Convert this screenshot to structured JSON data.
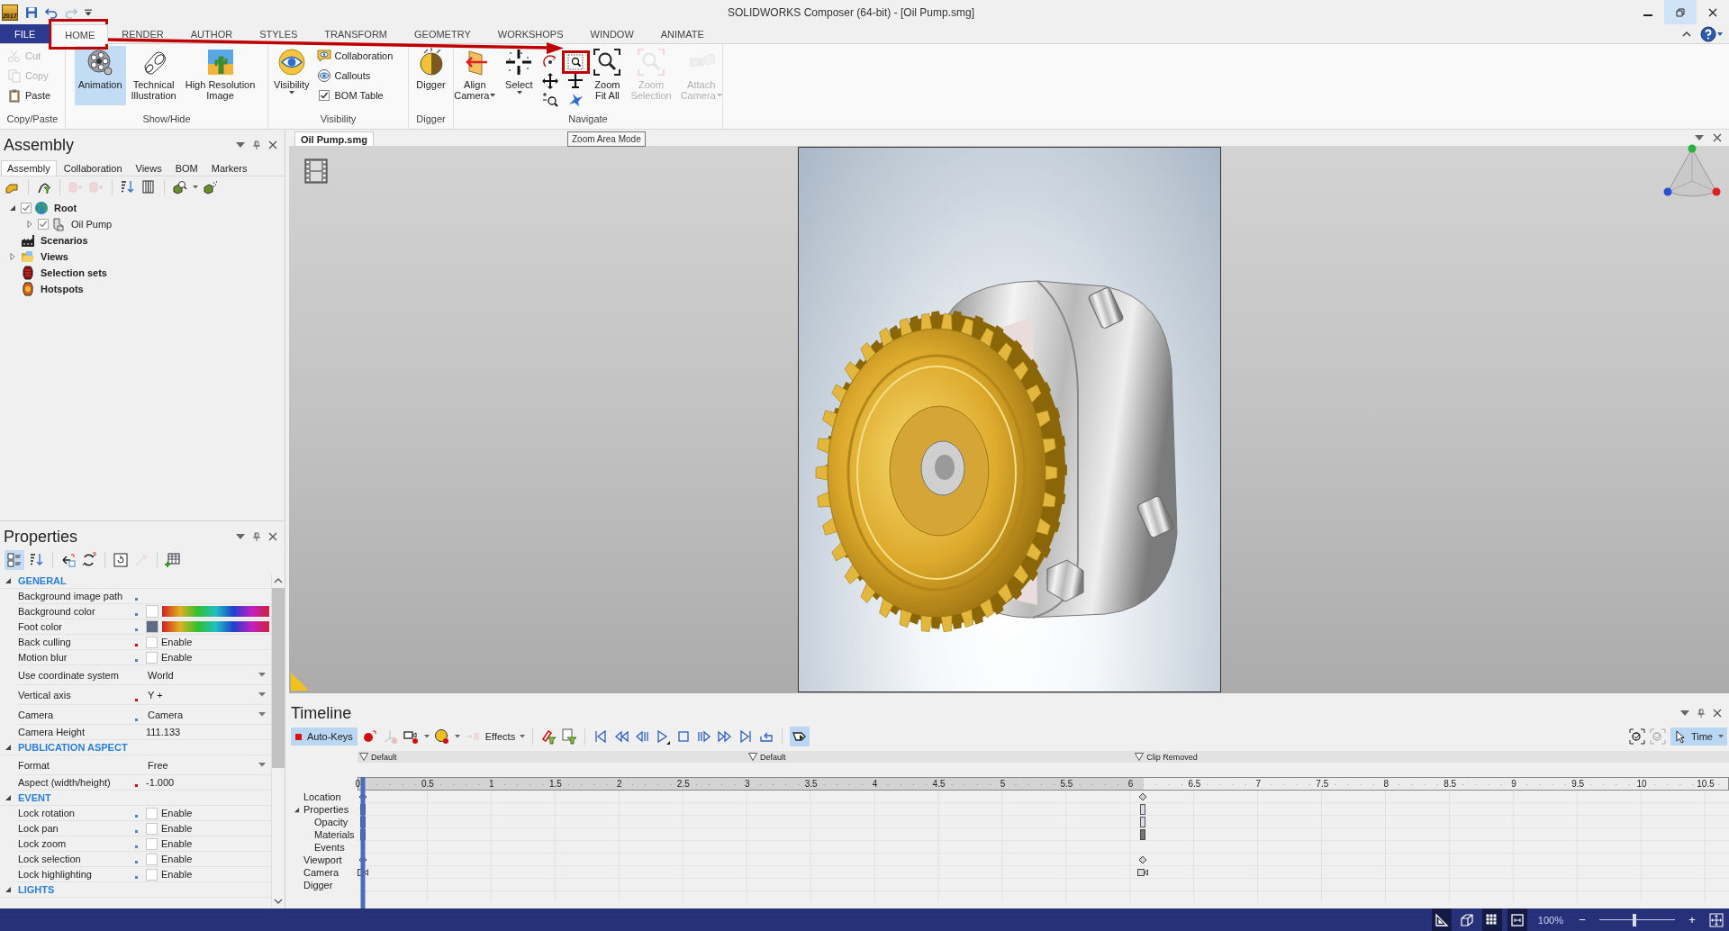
{
  "window": {
    "icon_text": "2017",
    "title": "SOLIDWORKS Composer (64-bit) - [Oil Pump.smg]"
  },
  "quick_access": [
    {
      "disabled": false
    },
    {
      "disabled": false
    },
    {
      "disabled": true
    }
  ],
  "window_controls": [
    {
      "kind": "minimize",
      "hovered": false
    },
    {
      "kind": "restore",
      "hovered": true
    },
    {
      "kind": "close",
      "hovered": false
    }
  ],
  "ribbon_tabs": [
    {
      "label": "FILE",
      "kind": "file",
      "selected": false
    },
    {
      "label": "HOME",
      "kind": "tab",
      "selected": true
    },
    {
      "label": "RENDER",
      "kind": "tab",
      "selected": false
    },
    {
      "label": "AUTHOR",
      "kind": "tab",
      "selected": false
    },
    {
      "label": "STYLES",
      "kind": "tab",
      "selected": false
    },
    {
      "label": "TRANSFORM",
      "kind": "tab",
      "selected": false
    },
    {
      "label": "GEOMETRY",
      "kind": "tab",
      "selected": false
    },
    {
      "label": "WORKSHOPS",
      "kind": "tab",
      "selected": false
    },
    {
      "label": "WINDOW",
      "kind": "tab",
      "selected": false
    },
    {
      "label": "ANIMATE",
      "kind": "tab",
      "selected": false
    }
  ],
  "ribbon_groups": [
    {
      "label": "Copy/Paste",
      "items": [
        {
          "label": "Cut",
          "disabled": true
        },
        {
          "label": "Copy",
          "disabled": true
        },
        {
          "label": "Paste",
          "disabled": false
        }
      ]
    },
    {
      "label": "Show/Hide",
      "items": [
        {
          "lines": [
            "Animation"
          ],
          "selected": true
        },
        {
          "lines": [
            "Technical",
            "Illustration"
          ],
          "selected": false
        },
        {
          "lines": [
            "High Resolution",
            "Image"
          ],
          "selected": false
        }
      ]
    },
    {
      "label": "Visibility",
      "items": [
        {
          "lines": [
            "Visibility"
          ],
          "menu": true
        }
      ],
      "small_items": [
        {
          "label": "Collaboration"
        },
        {
          "label": "Callouts"
        },
        {
          "label": "BOM Table",
          "checked": true
        }
      ]
    },
    {
      "label": "Digger",
      "items": [
        {
          "lines": [
            "Digger"
          ]
        }
      ]
    },
    {
      "label": "Navigate",
      "items": [
        {
          "lines": [
            "Align",
            "Camera"
          ],
          "menu": true,
          "disabled": false
        },
        {
          "lines": [
            "Select"
          ],
          "menu": true,
          "disabled": false
        },
        {
          "lines": [
            "Zoom",
            "Fit All"
          ],
          "menu": false,
          "disabled": false
        },
        {
          "lines": [
            "Zoom",
            "Selection"
          ],
          "menu": false,
          "disabled": true
        },
        {
          "lines": [
            "Attach",
            "Camera"
          ],
          "menu": true,
          "disabled": true
        }
      ]
    }
  ],
  "tooltip": "Zoom Area Mode",
  "assembly_panel": {
    "title": "Assembly",
    "tabs": [
      {
        "label": "Assembly",
        "selected": true
      },
      {
        "label": "Collaboration",
        "selected": false
      },
      {
        "label": "Views",
        "selected": false
      },
      {
        "label": "BOM",
        "selected": false
      },
      {
        "label": "Markers",
        "selected": false
      }
    ],
    "toolbar": [
      {
        "disabled": false
      },
      {
        "disabled": false
      },
      {
        "disabled": true
      },
      {
        "disabled": true
      },
      {
        "disabled": false
      },
      {
        "disabled": false
      },
      {
        "disabled": false
      },
      {
        "disabled": false
      }
    ],
    "tree": [
      {
        "label": "Root",
        "kind": "root",
        "expanded": true,
        "checked": true,
        "children": [
          {
            "label": "Oil Pump",
            "kind": "part",
            "expanded": false,
            "checked": true
          }
        ]
      },
      {
        "label": "Scenarios",
        "kind": "scenarios"
      },
      {
        "label": "Views",
        "kind": "views",
        "expanded": false
      },
      {
        "label": "Selection sets",
        "kind": "selection"
      },
      {
        "label": "Hotspots",
        "kind": "hotspots"
      }
    ]
  },
  "properties_panel": {
    "title": "Properties",
    "toolbar": [
      {
        "selected": true,
        "disabled": false
      },
      {
        "selected": false,
        "disabled": false
      },
      {
        "selected": false,
        "disabled": false
      },
      {
        "selected": false,
        "disabled": false
      },
      {
        "selected": false,
        "disabled": false
      },
      {
        "selected": false,
        "disabled": true
      },
      {
        "selected": false,
        "disabled": false
      }
    ],
    "sections": [
      {
        "label": "GENERAL",
        "expanded": true,
        "rows": [
          {
            "label": "Background image path",
            "color": "#4a86d0",
            "kind": "empty"
          },
          {
            "label": "Background color",
            "color": "#4a86d0",
            "kind": "color",
            "swatch": {
              "color": "#ffffff"
            }
          },
          {
            "label": "Foot color",
            "color": "#4a86d0",
            "kind": "color",
            "swatch": {
              "color": "#5d6b86"
            }
          },
          {
            "label": "Back culling",
            "color": "#e00000",
            "kind": "check",
            "checked": false,
            "value": "Enable"
          },
          {
            "label": "Motion blur",
            "color": "#4a86d0",
            "kind": "check",
            "checked": false,
            "value": "Enable"
          },
          {
            "label": "Use coordinate system",
            "kind": "dropdown",
            "value": "World"
          },
          {
            "label": "Vertical axis",
            "color": "#e00000",
            "kind": "dropdown",
            "value": "Y +"
          },
          {
            "label": "Camera",
            "color": "#4a86d0",
            "kind": "dropdown",
            "value": "Camera"
          },
          {
            "label": "Camera Height",
            "kind": "text",
            "value": "111.133"
          }
        ]
      },
      {
        "label": "PUBLICATION ASPECT",
        "expanded": true,
        "rows": [
          {
            "label": "Format",
            "kind": "dropdown",
            "value": "Free"
          },
          {
            "label": "Aspect (width/height)",
            "color": "#e00000",
            "kind": "text",
            "value": "-1.000"
          }
        ]
      },
      {
        "label": "EVENT",
        "expanded": true,
        "rows": [
          {
            "label": "Lock rotation",
            "color": "#4a86d0",
            "kind": "check",
            "checked": false,
            "value": "Enable"
          },
          {
            "label": "Lock pan",
            "color": "#4a86d0",
            "kind": "check",
            "checked": false,
            "value": "Enable"
          },
          {
            "label": "Lock zoom",
            "color": "#4a86d0",
            "kind": "check",
            "checked": false,
            "value": "Enable"
          },
          {
            "label": "Lock selection",
            "color": "#4a86d0",
            "kind": "check",
            "checked": false,
            "value": "Enable"
          },
          {
            "label": "Lock highlighting",
            "color": "#4a86d0",
            "kind": "check",
            "checked": false,
            "value": "Enable"
          }
        ]
      },
      {
        "label": "LIGHTS",
        "expanded": true
      }
    ]
  },
  "document_tabs": [
    {
      "label": "Oil Pump.smg",
      "selected": true
    }
  ],
  "timeline": {
    "title": "Timeline",
    "auto_keys": {
      "label": "Auto-Keys",
      "selected": true
    },
    "tools": [
      {
        "disabled": false
      },
      {
        "disabled": true
      },
      {
        "disabled": false
      },
      {
        "disabled": false
      }
    ],
    "effects": {
      "label": "Effects",
      "disabled": true
    },
    "view_toggle": {
      "selected": true
    },
    "right_tools": [
      {
        "disabled": false
      },
      {
        "disabled": true
      }
    ],
    "time_mode": {
      "label": "Time",
      "selected": true
    },
    "markers": [
      {
        "label": "Default",
        "level": 0
      },
      {
        "label": "Default",
        "level": 0.29
      },
      {
        "label": "Clip Removed",
        "level": 0.578
      }
    ],
    "ticks": [
      "0",
      "0.5",
      "1",
      "1.5",
      "2",
      "2.5",
      "3",
      "3.5",
      "4",
      "4.5",
      "5",
      "5.5",
      "6",
      "6.5",
      "7",
      "7.5",
      "8",
      "8.5",
      "9",
      "9.5",
      "10",
      "10.5"
    ],
    "duration": {
      "level": 0.581
    },
    "cursor": {
      "level": 0
    },
    "tracks": [
      {
        "label": "Location",
        "keys": [
          {
            "kind": "diamond",
            "level": 0
          },
          {
            "kind": "diamond",
            "level": 0.581
          }
        ]
      },
      {
        "label": "Properties",
        "expanded": true,
        "keys": [
          {
            "kind": "block",
            "level": 0
          },
          {
            "kind": "block",
            "level": 0.581
          }
        ],
        "children": [
          {
            "label": "Opacity",
            "keys": [
              {
                "kind": "block",
                "level": 0
              },
              {
                "kind": "block",
                "level": 0.581
              }
            ]
          },
          {
            "label": "Materials",
            "keys": [
              {
                "kind": "block",
                "level": 0
              },
              {
                "kind": "solid",
                "level": 0.581
              }
            ]
          },
          {
            "label": "Events"
          }
        ]
      },
      {
        "label": "Viewport",
        "keys": [
          {
            "kind": "diamond",
            "level": 0
          },
          {
            "kind": "diamond",
            "level": 0.581
          }
        ]
      },
      {
        "label": "Camera",
        "keys": [
          {
            "kind": "camera",
            "level": 0
          },
          {
            "kind": "camera",
            "level": 0.581
          }
        ]
      },
      {
        "label": "Digger"
      }
    ]
  },
  "status_bar": {
    "toggles": [
      {
        "selected": true
      },
      {
        "selected": false
      },
      {
        "selected": true
      },
      {
        "selected": true
      }
    ],
    "zoom_label": "100%",
    "zoom_out": "−",
    "zoom_in": "+",
    "zoom": {
      "level": 0.47
    }
  }
}
